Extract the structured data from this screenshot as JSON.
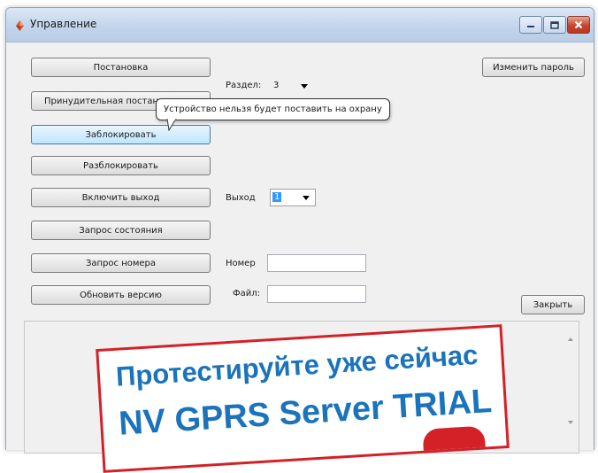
{
  "window": {
    "title": "Управление"
  },
  "buttons": {
    "postanovka": "Постановка",
    "prinuditelnaya": "Принудительная постановка",
    "zablokirovat": "Заблокировать",
    "razblokirovat": "Разблокировать",
    "vklyuchit_vyhod": "Включить выход",
    "zapros_sostoyaniya": "Запрос состояния",
    "zapros_nomera": "Запрос номера",
    "obnovit_versiyu": "Обновить версию",
    "izmenit_parol": "Изменить пароль",
    "zakryt": "Закрыть"
  },
  "fields": {
    "razdel_label": "Раздел:",
    "razdel_value": "3",
    "vyhod_label": "Выход",
    "vyhod_value": "1",
    "nomer_label": "Номер",
    "nomer_value": "",
    "fail_label": "Файл:",
    "fail_value": ""
  },
  "tooltip": {
    "text": "Устройство нельзя будет поставить на охрану"
  },
  "promo": {
    "line1": "Протестируйте уже сейчас",
    "line2": "NV GPRS Server TRIAL"
  },
  "icons": {
    "app": "app-icon",
    "minimize": "minimize-icon",
    "maximize": "maximize-icon",
    "close": "close-icon",
    "dropdown": "chevron-down-icon"
  },
  "colors": {
    "promo_text": "#1b73bb",
    "promo_border": "#d42027",
    "focus_button": "#bee6fd"
  }
}
